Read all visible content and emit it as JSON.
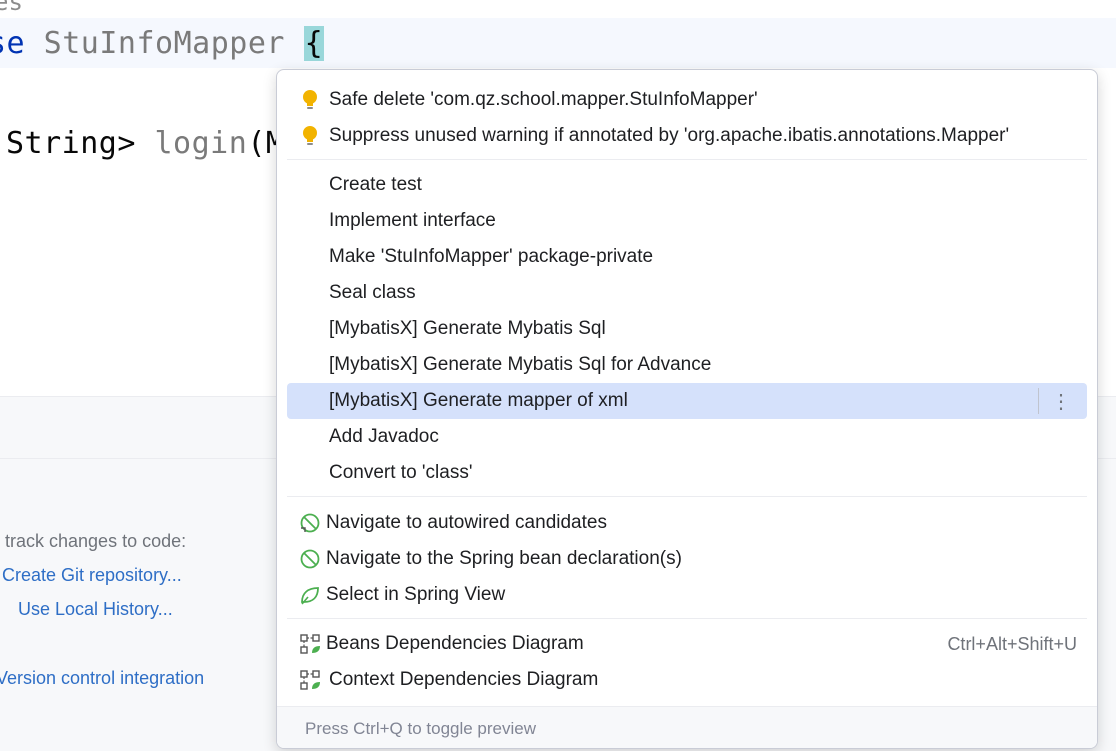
{
  "editor": {
    "top_fragment": "es",
    "line1_keyword": "se",
    "line1_class": " StuInfoMapper ",
    "line1_brace": "{",
    "line2_type": "String> ",
    "line2_method": "login",
    "line2_rest": "(M"
  },
  "vcs_panel": {
    "hint": "o track changes to code:",
    "create_repo_link": "Create Git repository...",
    "local_history_link": "Use Local History...",
    "integration_link": "Version control integration"
  },
  "popup": {
    "quick_fixes": [
      {
        "label": "Safe delete 'com.qz.school.mapper.StuInfoMapper'",
        "icon": "bulb-icon"
      },
      {
        "label": "Suppress unused warning if annotated by 'org.apache.ibatis.annotations.Mapper'",
        "icon": "bulb-icon"
      }
    ],
    "intentions": [
      {
        "label": "Create test"
      },
      {
        "label": "Implement interface"
      },
      {
        "label": "Make 'StuInfoMapper' package-private"
      },
      {
        "label": "Seal class"
      },
      {
        "label": "[MybatisX] Generate Mybatis Sql"
      },
      {
        "label": "[MybatisX] Generate Mybatis Sql for Advance"
      },
      {
        "label": "[MybatisX] Generate mapper of xml",
        "selected": true
      },
      {
        "label": "Add Javadoc"
      },
      {
        "label": "Convert to 'class'"
      }
    ],
    "spring_actions": [
      {
        "label": "Navigate to autowired candidates",
        "icon": "spring-autowired-icon"
      },
      {
        "label": "Navigate to the Spring bean declaration(s)",
        "icon": "spring-bean-icon"
      },
      {
        "label": "Select in Spring View",
        "icon": "spring-leaf-icon"
      }
    ],
    "diagram_actions": [
      {
        "label": "Beans Dependencies Diagram",
        "icon": "diagram-icon",
        "shortcut": "Ctrl+Alt+Shift+U"
      },
      {
        "label": "Context Dependencies Diagram",
        "icon": "diagram-icon"
      }
    ],
    "more_button": "⋮",
    "footer": "Press Ctrl+Q to toggle preview"
  },
  "colors": {
    "selection": "#d5e1fb",
    "bulb": "#f2b300",
    "spring_green": "#4caf50",
    "link": "#2e6ec6"
  }
}
